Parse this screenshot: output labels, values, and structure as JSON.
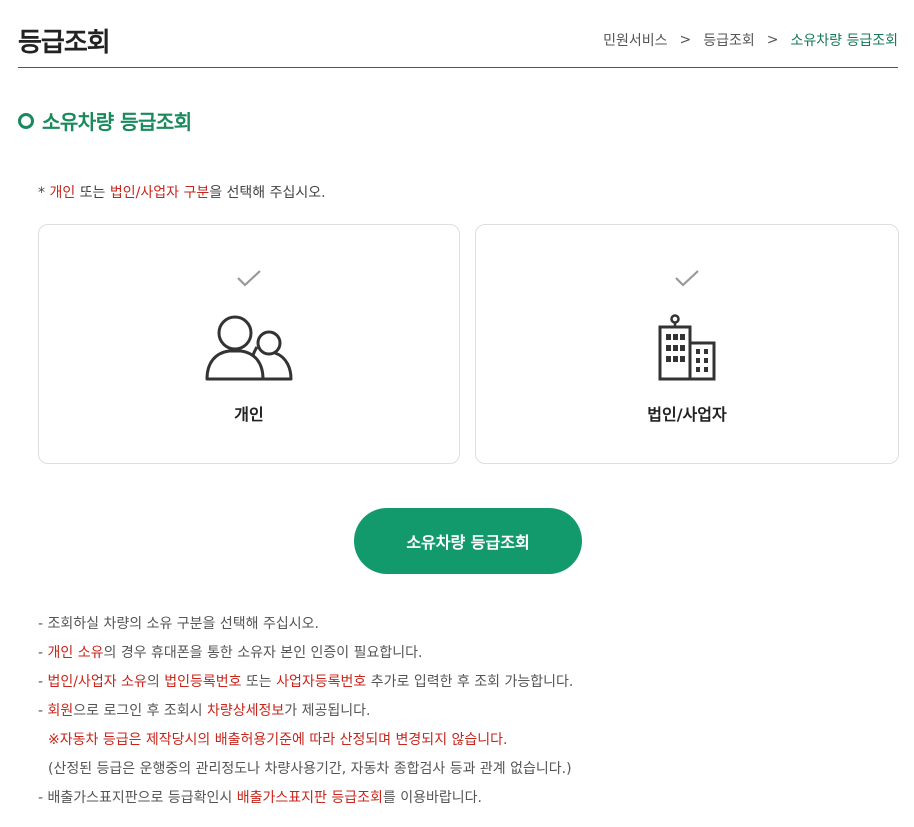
{
  "header": {
    "title": "등급조회",
    "breadcrumb": [
      "민원서비스",
      ">",
      "등급조회",
      ">",
      "소유차량 등급조회"
    ]
  },
  "section": {
    "title": "소유차량 등급조회"
  },
  "instruction": {
    "prefix": "* ",
    "w1": "개인",
    "t1": " 또는 ",
    "w2": "법인/사업자 구분",
    "t2": "을 선택해 주십시오."
  },
  "options": [
    {
      "label": "개인",
      "icon": "people-icon"
    },
    {
      "label": "법인/사업자",
      "icon": "building-icon"
    }
  ],
  "submit": {
    "label": "소유차량 등급조회"
  },
  "notes": {
    "n1": "- 조회하실 차량의 소유 구분을 선택해 주십시오.",
    "n2a": "- ",
    "n2b": "개인 소유",
    "n2c": "의 경우 휴대폰을 통한 소유자 본인 인증이 필요합니다.",
    "n3a": "- ",
    "n3b": "법인/사업자 소유",
    "n3c": "의 ",
    "n3d": "법인등록번호",
    "n3e": " 또는 ",
    "n3f": "사업자등록번호",
    "n3g": " 추가로 입력한 후 조회 가능합니다.",
    "n4a": "- ",
    "n4b": "회원",
    "n4c": "으로 로그인 후 조회시 ",
    "n4d": "차량상세정보",
    "n4e": "가 제공됩니다.",
    "n5": "※자동차 등급은 제작당시의 배출허용기준에 따라 산정되며 변경되지 않습니다.",
    "n6": "(산정된 등급은 운행중의 관리정도나 차량사용기간, 자동차 종합검사 등과 관계 없습니다.)",
    "n7a": "- 배출가스표지판으로 등급확인시 ",
    "n7b": "배출가스표지판 등급조회",
    "n7c": "를 이용바랍니다."
  },
  "colors": {
    "accent": "#139a6c",
    "accent_text": "#1a8a5c",
    "highlight": "#c8261c"
  }
}
